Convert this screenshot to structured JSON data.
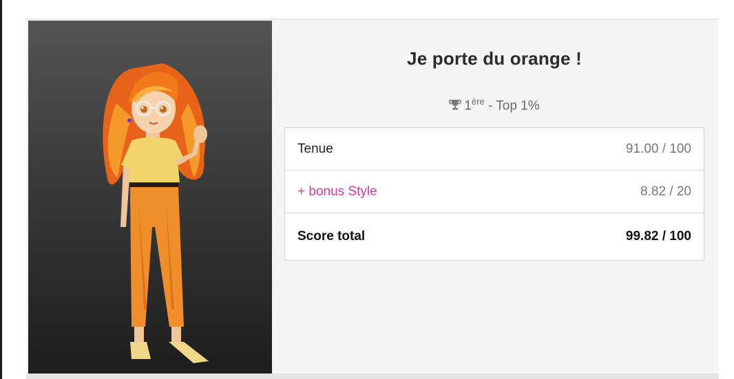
{
  "outfit": {
    "title": "Je porte du orange !",
    "rank_number": "1",
    "rank_suffix": "ère",
    "rank_rest": " - Top 1%",
    "trophy_icon": "trophy-icon"
  },
  "scores": {
    "rows": [
      {
        "label": "Tenue",
        "value": "91.00 / 100"
      },
      {
        "label": "+ bonus Style",
        "value": "8.82 / 20"
      },
      {
        "label": "Score total",
        "value": "99.82 / 100"
      }
    ]
  },
  "colors": {
    "bonus_accent": "#d63aa3",
    "panel_dark": "#1d1d1d",
    "hair_orange": "#f07a1a"
  }
}
